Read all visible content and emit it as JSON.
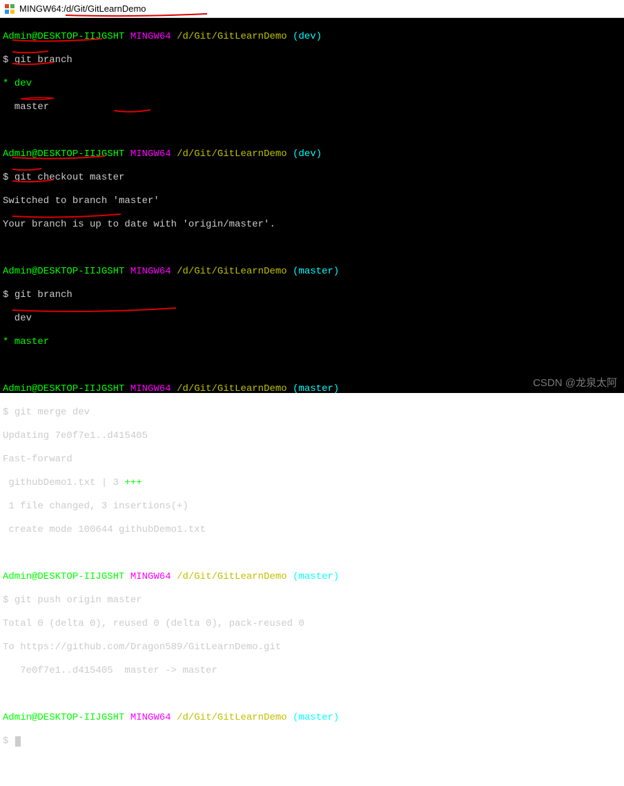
{
  "window": {
    "title": "MINGW64:/d/Git/GitLearnDemo"
  },
  "prompt": {
    "user_host": "Admin@DESKTOP-IIJGSHT",
    "env": "MINGW64",
    "path": "/d/Git/GitLearnDemo",
    "branch_dev": "(dev)",
    "branch_master": "(master)",
    "dollar": "$"
  },
  "session": {
    "block1": {
      "cmd": "git branch",
      "out1": "* dev",
      "out2": "  master"
    },
    "block2": {
      "cmd": "git checkout master",
      "out1": "Switched to branch 'master'",
      "out2": "Your branch is up to date with 'origin/master'."
    },
    "block3": {
      "cmd": "git branch",
      "out1": "  dev",
      "out2": "* master"
    },
    "block4": {
      "cmd": "git merge dev",
      "out1": "Updating 7e0f7e1..d415405",
      "out2": "Fast-forward",
      "out3": " githubDemo1.txt | 3 ",
      "out3_plus": "+++",
      "out4": " 1 file changed, 3 insertions(+)",
      "out5": " create mode 100644 githubDemo1.txt"
    },
    "block5": {
      "cmd": "git push origin master",
      "out1": "Total 0 (delta 0), reused 0 (delta 0), pack-reused 0",
      "out2": "To https://github.com/Dragon589/GitLearnDemo.git",
      "out3": "   7e0f7e1..d415405  master -> master"
    }
  },
  "watermark": "CSDN @龙泉太阿"
}
